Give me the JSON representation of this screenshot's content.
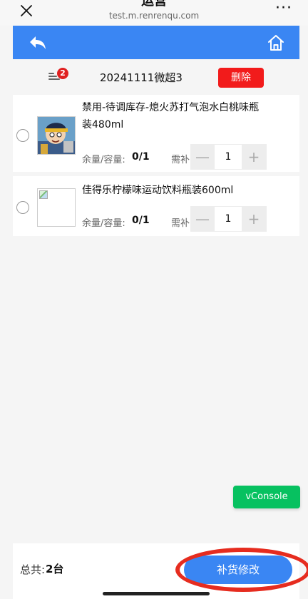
{
  "browser": {
    "title": "运营",
    "url": "test.m.renrenqu.com",
    "more_label": "···"
  },
  "toolbar": {
    "badge_count": "2",
    "group_title": "20241111微超3",
    "delete_label": "删除"
  },
  "items": [
    {
      "name_line1": "禁用-待调库存-熄火苏打气泡水白桃味瓶",
      "name_line2": "装480ml",
      "stock_label": "余量/容量:",
      "stock_value": "0/1",
      "need_label": "需补",
      "qty": "1",
      "minus": "—",
      "plus": "+"
    },
    {
      "name_line1": "佳得乐柠檬味运动饮料瓶装600ml",
      "name_line2": "",
      "stock_label": "余量/容量:",
      "stock_value": "0/1",
      "need_label": "需补",
      "qty": "1",
      "minus": "—",
      "plus": "+"
    }
  ],
  "vconsole_label": "vConsole",
  "footer": {
    "total_label": "总共:",
    "total_value": "2台",
    "submit_label": "补货修改"
  },
  "colors": {
    "header_blue": "#3a86f3",
    "delete_red": "#f21b1b",
    "vconsole_green": "#07c160",
    "annotation_red": "#e62c1f"
  }
}
